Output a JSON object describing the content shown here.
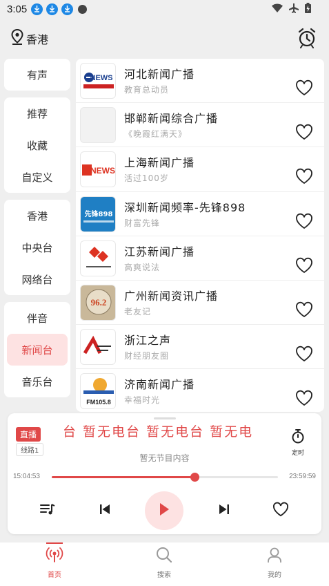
{
  "status_bar": {
    "time": "3:05"
  },
  "location": {
    "label": "香港"
  },
  "sidebar": {
    "groups": [
      {
        "items": [
          {
            "label": "有声"
          }
        ]
      },
      {
        "items": [
          {
            "label": "推荐"
          },
          {
            "label": "收藏"
          },
          {
            "label": "自定义"
          }
        ]
      },
      {
        "items": [
          {
            "label": "香港"
          },
          {
            "label": "中央台"
          },
          {
            "label": "网络台"
          }
        ]
      },
      {
        "items": [
          {
            "label": "伴音"
          },
          {
            "label": "新闻台",
            "active": true
          },
          {
            "label": "音乐台"
          }
        ]
      }
    ]
  },
  "stations": [
    {
      "title": "河北新闻广播",
      "subtitle": "教育总动员",
      "logo": "news-logo-hebei",
      "logo_text": "NEWS"
    },
    {
      "title": "邯郸新闻综合广播",
      "subtitle": "《晚霞红满天》",
      "logo": "blank-logo"
    },
    {
      "title": "上海新闻广播",
      "subtitle": "活过100岁",
      "logo": "news-logo-shanghai",
      "logo_text": "NEWS"
    },
    {
      "title": "深圳新闻频率-先锋898",
      "subtitle": "财富先锋",
      "logo": "shenzhen-logo",
      "logo_text": "先锋898"
    },
    {
      "title": "江苏新闻广播",
      "subtitle": "高爽说法",
      "logo": "jiangsu-logo"
    },
    {
      "title": "广州新闻资讯广播",
      "subtitle": "老友记",
      "logo": "guangzhou-logo",
      "logo_text": "96.2"
    },
    {
      "title": "浙江之声",
      "subtitle": "财经朋友圈",
      "logo": "zhejiang-logo"
    },
    {
      "title": "济南新闻广播",
      "subtitle": "幸福时光",
      "logo": "jinan-logo",
      "logo_text": "FM105.8"
    }
  ],
  "player": {
    "live_label": "直播",
    "line_label": "线路1",
    "marquee_text": "台   暂无电台   暂无电台   暂无电",
    "timer_label": "定时",
    "program_text": "暂无节目内容",
    "time_start": "15:04:53",
    "time_end": "23:59:59",
    "progress_fraction": 0.63
  },
  "tabs": [
    {
      "label": "首页",
      "icon": "radio-tower-icon",
      "active": true
    },
    {
      "label": "搜索",
      "icon": "search-icon"
    },
    {
      "label": "我的",
      "icon": "user-icon"
    }
  ],
  "colors": {
    "accent": "#e04848",
    "accent_light": "#fde2e2"
  }
}
